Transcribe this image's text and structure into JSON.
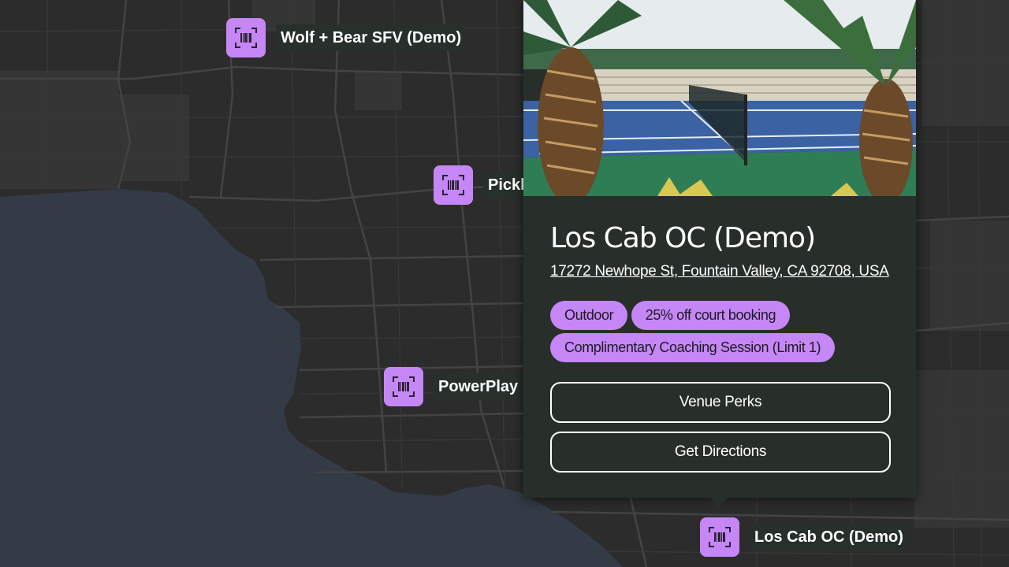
{
  "map": {
    "land_color": "#2c2c2c",
    "water_color": "#333b46",
    "road_color": "#3f3f3f",
    "park_color": "#383838",
    "marker_color": "#c587f5",
    "markers": [
      {
        "label": "Wolf + Bear SFV (Demo)",
        "icon": "barcode-scan-icon"
      },
      {
        "label": "Pickl",
        "icon": "barcode-scan-icon"
      },
      {
        "label": "PowerPlay",
        "icon": "barcode-scan-icon"
      },
      {
        "label": "Los Cab OC (Demo)",
        "icon": "barcode-scan-icon"
      }
    ]
  },
  "popup": {
    "photo": "tennis-court-with-palm-trees",
    "title": "Los Cab OC (Demo)",
    "address": "17272 Newhope St, Fountain Valley, CA 92708, USA",
    "tags": [
      "Outdoor",
      "25% off court booking",
      "Complimentary Coaching Session (Limit 1)"
    ],
    "buttons": {
      "perks": "Venue Perks",
      "directions": "Get Directions"
    },
    "background": "#282f2b"
  }
}
